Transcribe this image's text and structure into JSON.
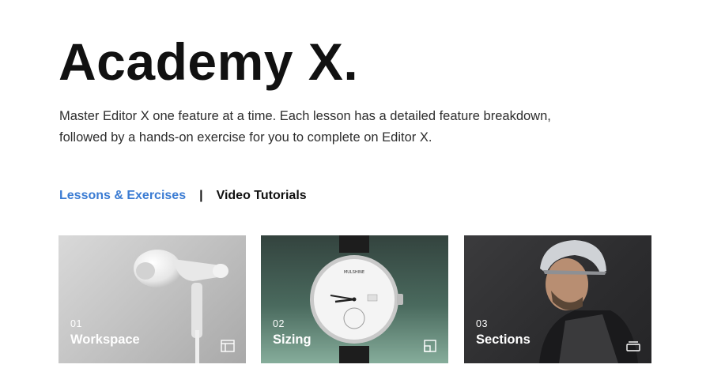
{
  "header": {
    "title": "Academy X.",
    "intro": "Master Editor X one feature at a time. Each lesson has a detailed feature breakdown, followed by a hands-on exercise for you to complete on Editor X."
  },
  "tabs": {
    "active": "Lessons & Exercises",
    "separator": "|",
    "other": "Video Tutorials"
  },
  "cards": [
    {
      "number": "01",
      "title": "Workspace",
      "icon": "layout-panel-icon"
    },
    {
      "number": "02",
      "title": "Sizing",
      "icon": "resize-corner-icon"
    },
    {
      "number": "03",
      "title": "Sections",
      "icon": "stacked-sections-icon"
    }
  ],
  "watch_brand": "MULSHINE",
  "colors": {
    "accent": "#3b7cd3",
    "text": "#111111"
  }
}
